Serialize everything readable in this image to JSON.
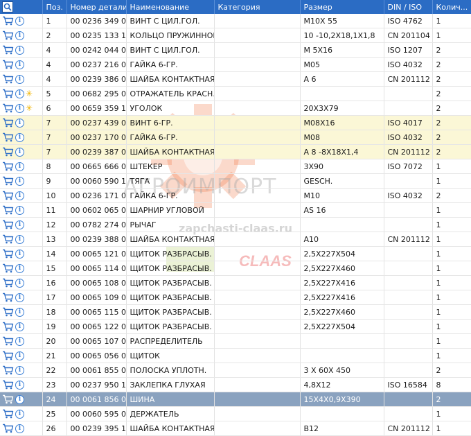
{
  "header": {
    "pos": "Поз.",
    "number": "Номер детали",
    "name": "Наименование",
    "category": "Категория",
    "size": "Размер",
    "din": "DIN / ISO",
    "qty": "Колич..."
  },
  "watermark": {
    "text": "АГРОИМПОРТ",
    "url": "zapchasti-claas.ru",
    "brand": "CLAAS"
  },
  "rows": [
    {
      "pos": "1",
      "number": "00 0236 349 0",
      "name": "ВИНТ С ЦИЛ.ГОЛ.",
      "category": "",
      "size": "M10X 55",
      "din": "ISO 4762",
      "qty": "1",
      "star": false,
      "style": ""
    },
    {
      "pos": "2",
      "number": "00 0235 133 1",
      "name": "КОЛЬЦО ПРУЖИННОЕ",
      "category": "",
      "size": "10 -10,2X18,1X1,8",
      "din": "CN 201104",
      "qty": "1",
      "star": false,
      "style": ""
    },
    {
      "pos": "4",
      "number": "00 0242 044 0",
      "name": "ВИНТ С ЦИЛ.ГОЛ.",
      "category": "",
      "size": "M 5X16",
      "din": "ISO 1207",
      "qty": "2",
      "star": false,
      "style": ""
    },
    {
      "pos": "4",
      "number": "00 0237 216 0",
      "name": "ГАЙКА 6-ГР.",
      "category": "",
      "size": "M05",
      "din": "ISO 4032",
      "qty": "2",
      "star": false,
      "style": ""
    },
    {
      "pos": "4",
      "number": "00 0239 386 0",
      "name": "ШАЙБА КОНТАКТНАЯ",
      "category": "",
      "size": "A 6",
      "din": "CN 201112",
      "qty": "2",
      "star": false,
      "style": ""
    },
    {
      "pos": "5",
      "number": "00 0682 295 0",
      "name": "ОТРАЖАТЕЛЬ КРАСН.",
      "category": "",
      "size": "",
      "din": "",
      "qty": "2",
      "star": true,
      "style": ""
    },
    {
      "pos": "6",
      "number": "00 0659 359 1",
      "name": "УГОЛОК",
      "category": "",
      "size": "20X3X79",
      "din": "",
      "qty": "2",
      "star": true,
      "style": ""
    },
    {
      "pos": "7",
      "number": "00 0237 439 0",
      "name": "ВИНТ 6-ГР.",
      "category": "",
      "size": "M08X16",
      "din": "ISO 4017",
      "qty": "2",
      "star": false,
      "style": "hl"
    },
    {
      "pos": "7",
      "number": "00 0237 170 0",
      "name": "ГАЙКА 6-ГР.",
      "category": "",
      "size": "M08",
      "din": "ISO 4032",
      "qty": "2",
      "star": false,
      "style": "hl"
    },
    {
      "pos": "7",
      "number": "00 0239 387 0",
      "name": "ШАЙБА КОНТАКТНАЯ",
      "category": "",
      "size": "A 8 -8X18X1,4",
      "din": "CN 201112",
      "qty": "2",
      "star": false,
      "style": "hl"
    },
    {
      "pos": "8",
      "number": "00 0665 666 0",
      "name": "ШТЕКЕР",
      "category": "",
      "size": "3X90",
      "din": "ISO 7072",
      "qty": "1",
      "star": false,
      "style": ""
    },
    {
      "pos": "9",
      "number": "00 0060 590 1",
      "name": "ТЯГА",
      "category": "",
      "size": "GESCH.",
      "din": "",
      "qty": "1",
      "star": false,
      "style": ""
    },
    {
      "pos": "10",
      "number": "00 0236 171 0",
      "name": "ГАЙКА 6-ГР.",
      "category": "",
      "size": "M10",
      "din": "ISO 4032",
      "qty": "2",
      "star": false,
      "style": ""
    },
    {
      "pos": "11",
      "number": "00 0602 065 0",
      "name": "ШАРНИР УГЛОВОЙ",
      "category": "",
      "size": "AS 16",
      "din": "",
      "qty": "1",
      "star": false,
      "style": ""
    },
    {
      "pos": "12",
      "number": "00 0782 274 0",
      "name": "РЫЧАГ",
      "category": "",
      "size": "",
      "din": "",
      "qty": "1",
      "star": false,
      "style": ""
    },
    {
      "pos": "13",
      "number": "00 0239 388 0",
      "name": "ШАЙБА КОНТАКТНАЯ",
      "category": "",
      "size": "A10",
      "din": "CN 201112",
      "qty": "1",
      "star": false,
      "style": ""
    },
    {
      "pos": "14",
      "number": "00 0065 121 0",
      "name": "ЩИТОК РАЗБРАСЫВ.",
      "category": "",
      "size": "2,5X227X504",
      "din": "",
      "qty": "1",
      "star": false,
      "style": ""
    },
    {
      "pos": "15",
      "number": "00 0065 114 0",
      "name": "ЩИТОК РАЗБРАСЫВ.",
      "category": "",
      "size": "2,5X227X460",
      "din": "",
      "qty": "1",
      "star": false,
      "style": ""
    },
    {
      "pos": "16",
      "number": "00 0065 108 0",
      "name": "ЩИТОК РАЗБРАСЫВ.",
      "category": "",
      "size": "2,5X227X416",
      "din": "",
      "qty": "1",
      "star": false,
      "style": ""
    },
    {
      "pos": "17",
      "number": "00 0065 109 0",
      "name": "ЩИТОК РАЗБРАСЫВ.",
      "category": "",
      "size": "2,5X227X416",
      "din": "",
      "qty": "1",
      "star": false,
      "style": ""
    },
    {
      "pos": "18",
      "number": "00 0065 115 0",
      "name": "ЩИТОК РАЗБРАСЫВ.",
      "category": "",
      "size": "2,5X227X460",
      "din": "",
      "qty": "1",
      "star": false,
      "style": ""
    },
    {
      "pos": "19",
      "number": "00 0065 122 0",
      "name": "ЩИТОК РАЗБРАСЫВ.",
      "category": "",
      "size": "2,5X227X504",
      "din": "",
      "qty": "1",
      "star": false,
      "style": ""
    },
    {
      "pos": "20",
      "number": "00 0065 107 0",
      "name": "РАСПРЕДЕЛИТЕЛЬ",
      "category": "",
      "size": "",
      "din": "",
      "qty": "1",
      "star": false,
      "style": ""
    },
    {
      "pos": "21",
      "number": "00 0065 056 0",
      "name": "ЩИТОК",
      "category": "",
      "size": "",
      "din": "",
      "qty": "1",
      "star": false,
      "style": ""
    },
    {
      "pos": "22",
      "number": "00 0061 855 0",
      "name": "ПОЛОСКА УПЛОТН.",
      "category": "",
      "size": "3  X 60X 450",
      "din": "",
      "qty": "2",
      "star": false,
      "style": ""
    },
    {
      "pos": "23",
      "number": "00 0237 950 1",
      "name": "ЗАКЛЕПКА ГЛУХАЯ",
      "category": "",
      "size": "4,8X12",
      "din": "ISO 16584",
      "qty": "8",
      "star": false,
      "style": ""
    },
    {
      "pos": "24",
      "number": "00 0061 856 0",
      "name": "ШИНА",
      "category": "",
      "size": "15X4X0,9X390",
      "din": "",
      "qty": "2",
      "star": false,
      "style": "sel"
    },
    {
      "pos": "25",
      "number": "00 0060 595 0",
      "name": "ДЕРЖАТЕЛЬ",
      "category": "",
      "size": "",
      "din": "",
      "qty": "1",
      "star": false,
      "style": ""
    },
    {
      "pos": "26",
      "number": "00 0239 395 1",
      "name": "ШАЙБА КОНТАКТНАЯ",
      "category": "",
      "size": "B12",
      "din": "CN 201112",
      "qty": "1",
      "star": false,
      "style": ""
    }
  ]
}
